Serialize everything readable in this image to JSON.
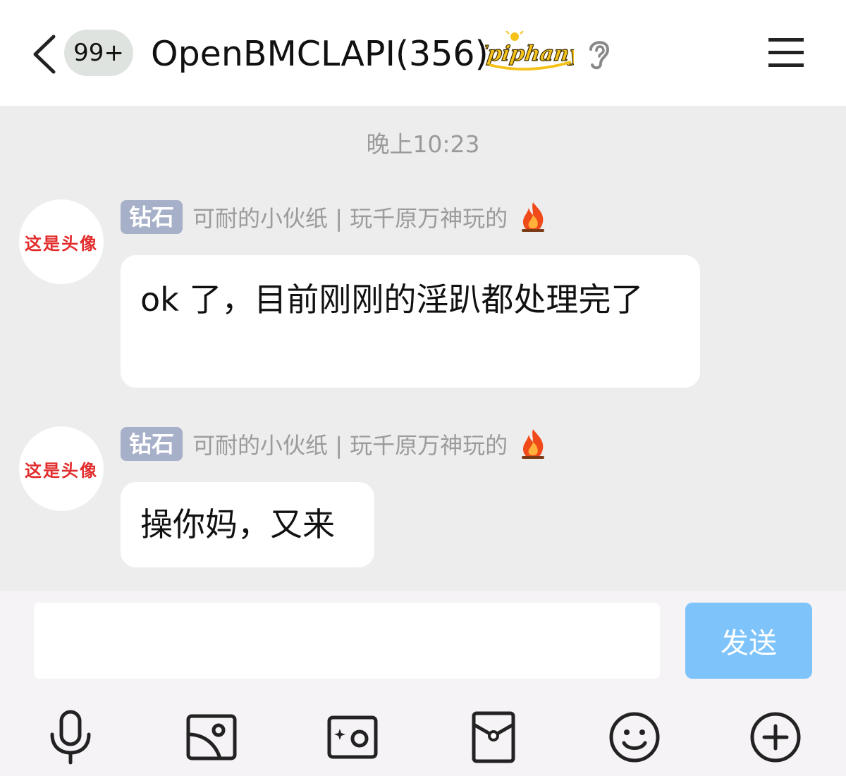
{
  "header": {
    "unread_badge": "99+",
    "title": "OpenBMCLAPI(356)",
    "logo_text": "Epiphany",
    "icons": [
      "back-chevron-icon",
      "ear-icon",
      "menu-icon"
    ]
  },
  "chat": {
    "time_divider": "晚上10:23",
    "messages": [
      {
        "avatar_text": "这是头像",
        "rank": "钻石",
        "sender": "可耐的小伙纸 | 玩千原万神玩的",
        "sender_icon": "fire-icon",
        "text": "ok 了，目前刚刚的淫趴都处理完了"
      },
      {
        "avatar_text": "这是头像",
        "rank": "钻石",
        "sender": "可耐的小伙纸 | 玩千原万神玩的",
        "sender_icon": "fire-icon",
        "text": "操你妈，又来"
      }
    ]
  },
  "composer": {
    "input_value": "",
    "send_label": "发送",
    "tools": [
      "microphone-icon",
      "image-icon",
      "camera-icon",
      "red-packet-icon",
      "emoji-icon",
      "plus-icon"
    ]
  },
  "colors": {
    "send_button": "#7ec4fb",
    "rank_badge": "#a7b0c9",
    "chat_background": "#ededed",
    "avatar_text": "#e22b2b"
  }
}
